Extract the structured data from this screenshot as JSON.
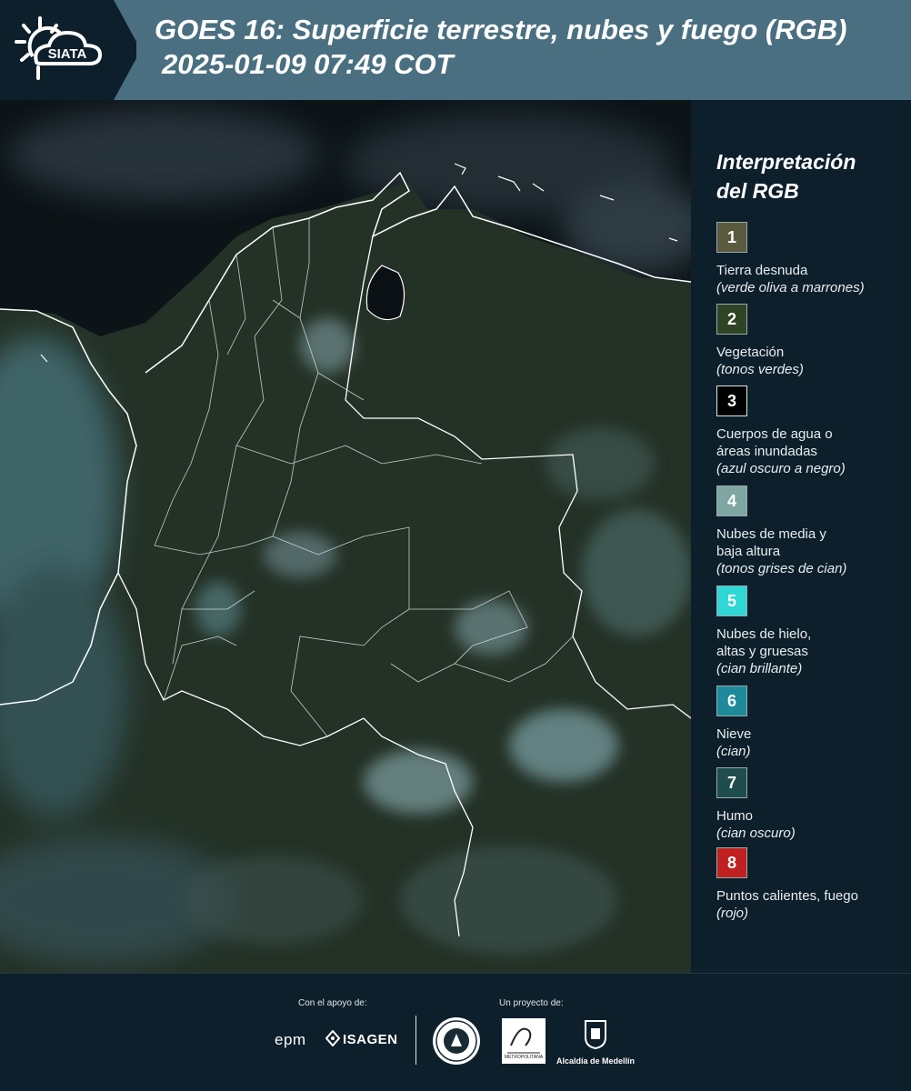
{
  "header": {
    "logo_text": "SIATA",
    "title_line1": "GOES 16: Superficie terrestre, nubes y fuego (RGB)",
    "title_line2": "2025-01-09 07:49 COT"
  },
  "legend": {
    "title_line1": "Interpretación",
    "title_line2": "del RGB",
    "items": [
      {
        "number": "1",
        "color": "#5c5a3e",
        "label": "Tierra desnuda",
        "sub": "(verde oliva a marrones)"
      },
      {
        "number": "2",
        "color": "#2f4424",
        "label": "Vegetación",
        "sub": "(tonos verdes)"
      },
      {
        "number": "3",
        "color": "#000000",
        "label_lines": [
          "Cuerpos de agua o",
          "áreas inundadas"
        ],
        "sub": "(azul oscuro a negro)"
      },
      {
        "number": "4",
        "color": "#7fa6a3",
        "label_lines": [
          "Nubes de media y",
          "baja altura"
        ],
        "sub": "(tonos grises de cian)"
      },
      {
        "number": "5",
        "color": "#2fd7d6",
        "label_lines": [
          "Nubes de hielo,",
          "altas y gruesas"
        ],
        "sub": "(cian brillante)"
      },
      {
        "number": "6",
        "color": "#1f8a9c",
        "label": "Nieve",
        "sub": "(cian)"
      },
      {
        "number": "7",
        "color": "#1f4c4c",
        "label": "Humo",
        "sub": "(cian oscuro)"
      },
      {
        "number": "8",
        "color": "#c0201f",
        "label": "Puntos calientes, fuego",
        "sub": "(rojo)"
      }
    ]
  },
  "footer": {
    "support_label": "Con el apoyo de:",
    "project_label": "Un proyecto de:",
    "sponsors": [
      "epm",
      "ISAGEN"
    ],
    "partners": [
      "METROPOLITANA",
      "Alcaldía de Medellín"
    ]
  }
}
